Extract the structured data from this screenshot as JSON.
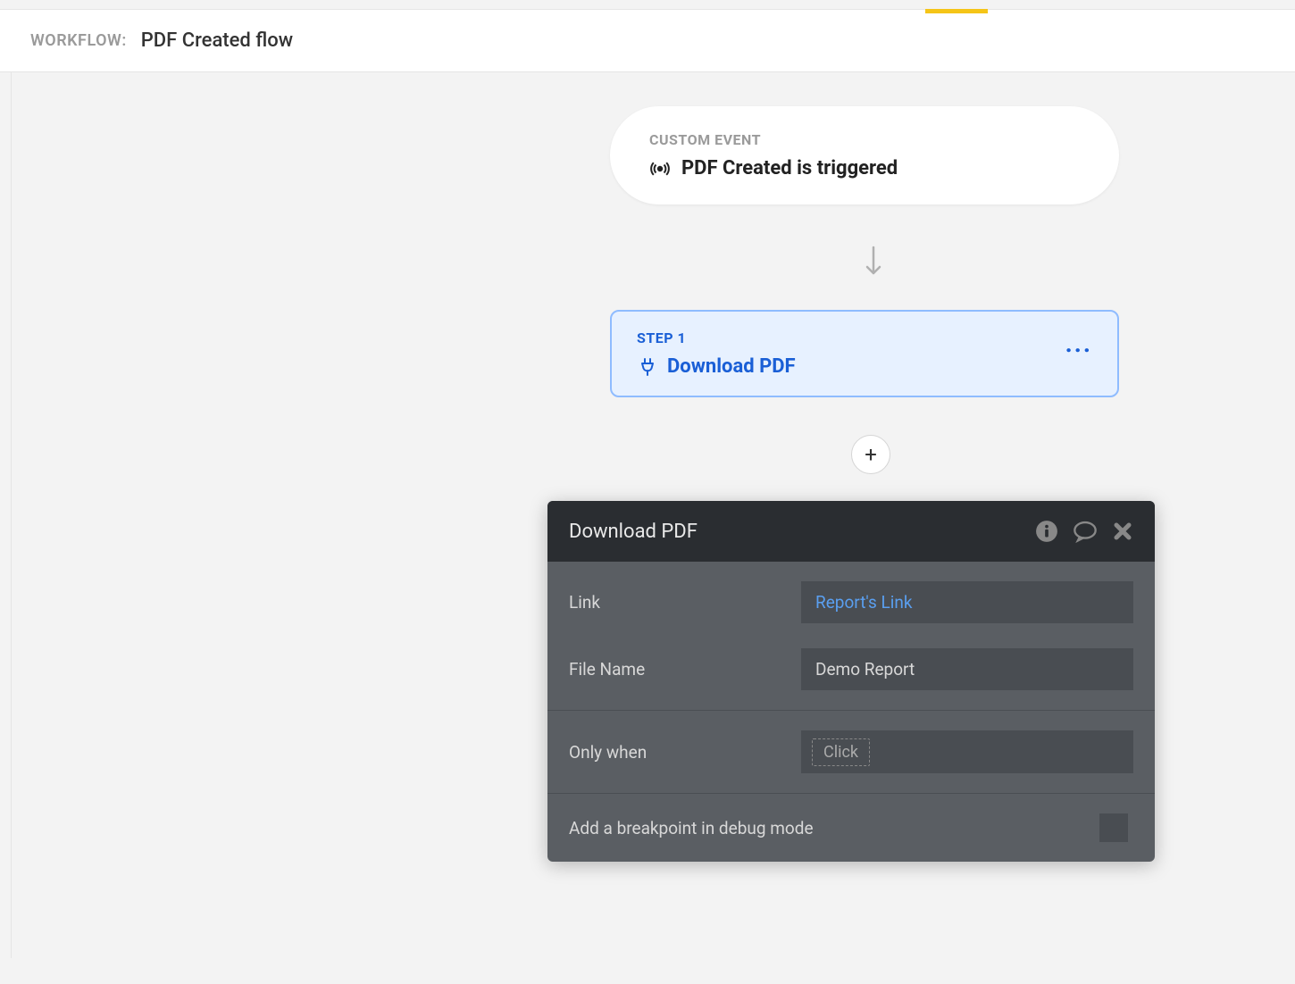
{
  "header": {
    "label": "WORKFLOW:",
    "title": "PDF Created flow"
  },
  "event_node": {
    "label": "CUSTOM EVENT",
    "title": "PDF Created is triggered"
  },
  "step_node": {
    "label": "STEP 1",
    "title": "Download PDF"
  },
  "panel": {
    "title": "Download PDF",
    "fields": {
      "link": {
        "label": "Link",
        "value": "Report's Link"
      },
      "filename": {
        "label": "File Name",
        "value": "Demo Report"
      },
      "onlywhen": {
        "label": "Only when",
        "placeholder": "Click"
      },
      "breakpoint": {
        "label": "Add a breakpoint in debug mode"
      }
    }
  },
  "add_button": "+"
}
